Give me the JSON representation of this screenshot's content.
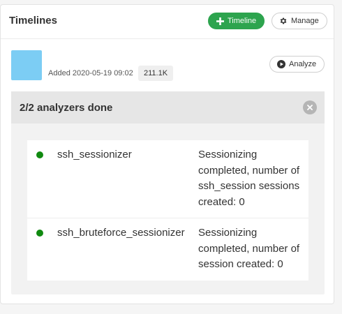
{
  "header": {
    "title": "Timelines",
    "add_timeline_label": "Timeline",
    "manage_label": "Manage"
  },
  "timeline": {
    "color": "#7ccdf4",
    "added": "Added 2020-05-19 09:02",
    "size": "211.1K",
    "analyze_label": "Analyze"
  },
  "analyzers": {
    "status": "2/2 analyzers done",
    "items": [
      {
        "name": "ssh_sessionizer",
        "status_color": "#108a10",
        "result": "Sessionizing completed, number of ssh_session sessions created: 0"
      },
      {
        "name": "ssh_bruteforce_sessionizer",
        "status_color": "#108a10",
        "result": "Sessionizing completed, number of session created: 0"
      }
    ]
  },
  "colors": {
    "primary_button": "#2da44e",
    "status_done": "#108a10"
  },
  "icons": {
    "add": "plus-icon",
    "manage": "gear-icon",
    "analyze": "play-circle-icon",
    "close": "close-circle-icon"
  }
}
